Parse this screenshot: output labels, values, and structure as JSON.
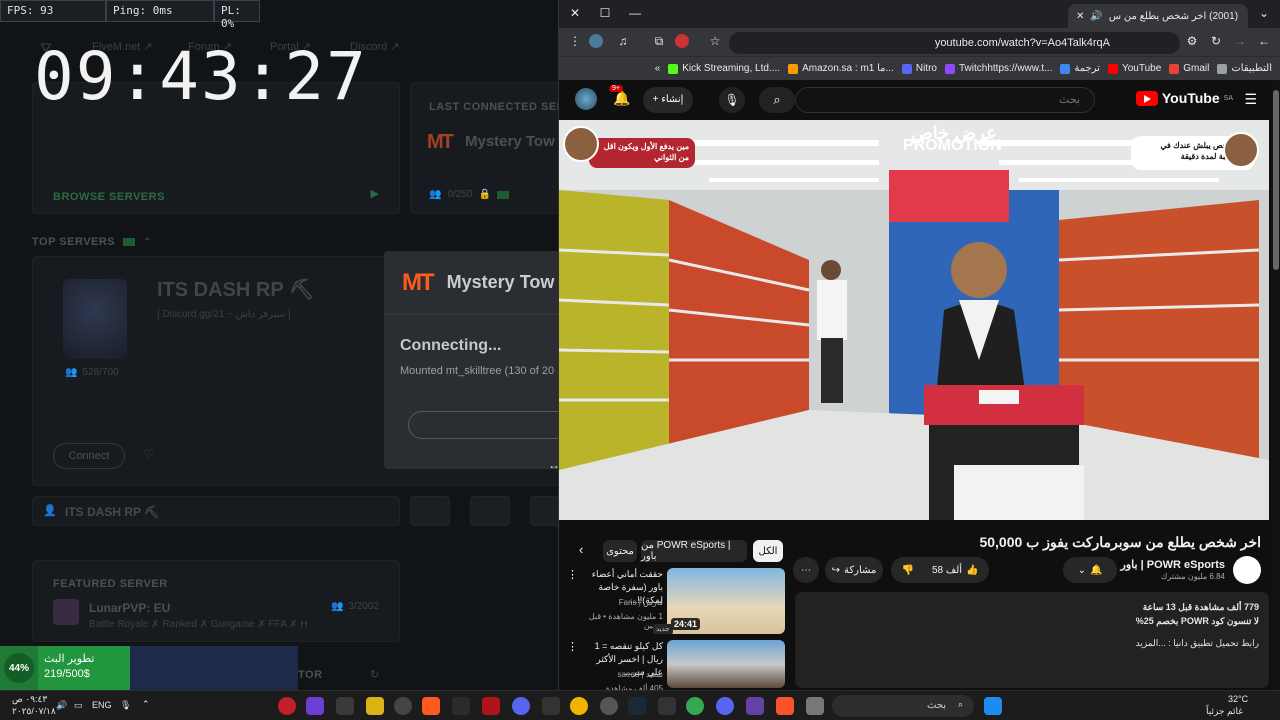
{
  "overlay": {
    "fps": "FPS: 93",
    "ping": "Ping: 0ms",
    "pl": "PL: 0%",
    "clock": "09:43:27"
  },
  "fivem": {
    "nav": [
      "FiveM.net ↗",
      "Forum ↗",
      "Portal ↗",
      "Discord ↗"
    ],
    "last_connected_label": "LAST CONNECTED SERVER",
    "last_connected_name": "Mystery Tow",
    "last_connected_players": "0/250",
    "browse_servers": "BROWSE SERVERS",
    "top_servers_label": "TOP SERVERS",
    "top_server_name": "ITS DASH RP ⛏",
    "top_server_discord": "[ Discord.gg/21 ~ سيرفر داش ]",
    "top_server_players": "528/700",
    "connect_button": "Connect",
    "row_server_name": "ITS DASH RP ⛏",
    "featured_label": "FEATURED SERVER",
    "featured_name": "LunarPVP: EU",
    "featured_players": "3/2002",
    "featured_desc": "Battle Royale ✗ Ranked ✗ Gungame ✗ FFA ✗ H",
    "bottom_label": "TOR"
  },
  "modal": {
    "title": "Mystery Tow",
    "status": "Connecting...",
    "detail": "Mounted mt_skilltree (130 of 20"
  },
  "stream_widget": {
    "percent": "44%",
    "title": "تطوير البث",
    "amount": "219/500$"
  },
  "chrome": {
    "tab_title": "(2001) اخر شخص يطلع من س",
    "url": "youtube.com/watch?v=Ao4Talk4rqA",
    "bookmarks": [
      "التطبيقات",
      "Gmail",
      "YouTube",
      "ترجمة",
      "Twitchhttps://www.t...",
      "Nitro",
      "Amazon.sa : m1 ما...",
      "Kick Streaming, Ltd...."
    ]
  },
  "youtube": {
    "logo": "YouTube",
    "logo_region": "SA",
    "search_placeholder": "بحث",
    "create_label": "إنشاء",
    "notif_count": "9+",
    "video_title": "اخر شخص يطلع من سوبرماركت يفوز ب 50,000",
    "channel_name": "POWR eSports | باور",
    "subscribers": "6.84 مليون مشترك",
    "likes": "58 ألف",
    "share_label": "مشاركة",
    "desc_stats": "779 ألف مشاهدة  قبل 13 ساعة",
    "desc_line1": "لا تنسون كود POWR بخصم 25%",
    "desc_line2": "رابط تحميل تطبيق دانيا : ...المزيد",
    "chips": [
      "الكل",
      "من POWR eSports | باور",
      "محتوى"
    ],
    "video_overlay_right": "كان شخص يبلش عندك في المحاسبة لمدة دقيقة",
    "video_overlay_left": "مين يدفع الأول ويكون اقل من الثواني",
    "video_sign_top": "عرض خاص",
    "video_sign": "PROMOTION",
    "recs": [
      {
        "title": "حققت أماني أعضاء باور (سفرة خاصة لمكة)!!...",
        "channel": "فارس | Faris",
        "views": "1 مليون مشاهدة • قبل يومين",
        "badge": "جديد",
        "duration": "24:41"
      },
      {
        "title": "كل كيلو تنقصه = 1 ريال | اخسر الأكثر على سر...",
        "channel": "سعيد | saeed",
        "views": "405 ألف مشاهدة",
        "duration": ""
      }
    ]
  },
  "taskbar": {
    "lang": "ENG",
    "time": "٠٩:٤٣ ص",
    "date": "٢٠٢٥/٠٧/١٨",
    "search": "بحث",
    "temp": "32°C",
    "weather": "غائم جزئياً"
  },
  "colors": {
    "accent_green": "#22963f",
    "youtube_red": "#ff0000",
    "fivem_orange": "#ff5a1f"
  }
}
